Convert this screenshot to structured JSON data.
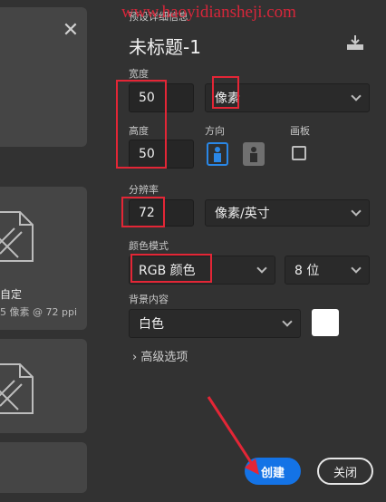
{
  "watermark": "www.haoyidiansheji.com",
  "gallery": {
    "card_title": "自定",
    "card_subtitle": "5 像素 @ 72 ppi"
  },
  "panel": {
    "section_label": "预设详细信息",
    "document_title": "未标题-1",
    "width_label": "宽度",
    "width_value": "50",
    "width_unit": "像素",
    "height_label": "高度",
    "height_value": "50",
    "orientation_label": "方向",
    "artboard_label": "画板",
    "resolution_label": "分辨率",
    "resolution_value": "72",
    "resolution_unit": "像素/英寸",
    "color_mode_label": "颜色模式",
    "color_mode_value": "RGB 颜色",
    "bit_depth_value": "8 位",
    "background_label": "背景内容",
    "background_value": "白色",
    "background_swatch": "#ffffff",
    "advanced_label": "高级选项"
  },
  "buttons": {
    "create": "创建",
    "close": "关闭"
  },
  "colors": {
    "accent": "#1473e6",
    "highlight": "#e32636"
  }
}
